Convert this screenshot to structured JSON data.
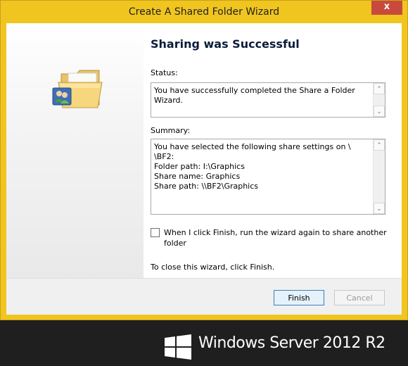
{
  "window": {
    "title": "Create A Shared Folder Wizard",
    "close_label": "x"
  },
  "page": {
    "heading": "Sharing was Successful"
  },
  "status": {
    "label": "Status:",
    "text": "You have successfully completed the Share a Folder Wizard."
  },
  "summary": {
    "label": "Summary:",
    "lines": [
      "You have selected the following share settings on \\",
      "\\BF2:",
      "Folder path: I:\\Graphics",
      "Share name: Graphics",
      "Share path: \\\\BF2\\Graphics"
    ]
  },
  "rerun": {
    "label": "When I click Finish, run the wizard again to share another folder",
    "checked": false
  },
  "footer": {
    "instruction": "To close this wizard, click Finish."
  },
  "buttons": {
    "finish": "Finish",
    "cancel": "Cancel"
  },
  "scroll": {
    "up": "⌃",
    "down": "⌄"
  },
  "branding": {
    "text": "Windows Server 2012 R2"
  },
  "colors": {
    "window_frame": "#f0c51f",
    "close_button": "#c94a3c",
    "brand_bg": "#1f1f1f"
  }
}
